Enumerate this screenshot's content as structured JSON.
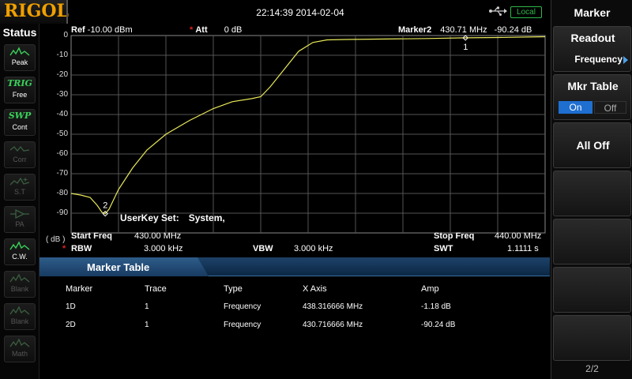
{
  "brand": {
    "logo": "RIGOL"
  },
  "topbar": {
    "datetime": "22:14:39 2014-02-04",
    "local_label": "Local",
    "usb_icon": "usb-icon"
  },
  "status": {
    "title": "Status",
    "buttons": [
      {
        "icon": "peak-icon",
        "label": "Peak",
        "active": true
      },
      {
        "icon": "TRIG",
        "label": "Free",
        "active": true
      },
      {
        "icon": "SWP",
        "label": "Cont",
        "active": true
      },
      {
        "icon": "corr-icon",
        "label": "Corr",
        "active": false
      },
      {
        "icon": "st-icon",
        "label": "S.T",
        "active": false
      },
      {
        "icon": "pa-icon",
        "label": "PA",
        "active": false
      },
      {
        "icon": "cw-icon",
        "label": "C.W.",
        "active": true
      },
      {
        "icon": "blank-icon",
        "label": "Blank",
        "active": false
      },
      {
        "icon": "blank-icon",
        "label": "Blank",
        "active": false
      },
      {
        "icon": "math-icon",
        "label": "Math",
        "active": false
      }
    ]
  },
  "header": {
    "ref_label": "Ref",
    "ref_value": "-10.00 dBm",
    "att_label": "Att",
    "att_value": "0 dB",
    "marker_label": "Marker2",
    "marker_freq": "430.71 MHz",
    "marker_amp": "-90.24 dB"
  },
  "plot": {
    "y_ticks": [
      "0",
      "-10",
      "-20",
      "-30",
      "-40",
      "-50",
      "-60",
      "-70",
      "-80",
      "-90"
    ],
    "unit": "( dB )",
    "userkey_label": "UserKey Set:",
    "userkey_value": "System,",
    "marker1_label": "1",
    "marker2_label": "2",
    "start_freq_label": "Start Freq",
    "start_freq_value": "430.00 MHz",
    "stop_freq_label": "Stop Freq",
    "stop_freq_value": "440.00 MHz",
    "rbw_label": "RBW",
    "rbw_value": "3.000 kHz",
    "vbw_label": "VBW",
    "vbw_value": "3.000 kHz",
    "swt_label": "SWT",
    "swt_value": "1.1111 s",
    "trace_color": "#e8e85a",
    "grid_color": "#555555"
  },
  "chart_data": {
    "type": "line",
    "xlim": [
      430.0,
      440.0
    ],
    "ylim": [
      -100,
      0
    ],
    "x": [
      430.0,
      430.2,
      430.4,
      430.55,
      430.65,
      430.72,
      430.8,
      431.0,
      431.3,
      431.6,
      432.0,
      432.5,
      433.0,
      433.4,
      433.8,
      434.0,
      434.2,
      434.5,
      434.8,
      435.1,
      435.4,
      435.8,
      436.5,
      437.5,
      438.32,
      439.0,
      440.0
    ],
    "y": [
      -80,
      -80.8,
      -82,
      -86,
      -89.5,
      -90.24,
      -88,
      -78,
      -67,
      -58,
      -50,
      -43,
      -37,
      -33.5,
      -32,
      -31,
      -26,
      -17,
      -8,
      -3.5,
      -2.2,
      -2.0,
      -1.8,
      -1.5,
      -1.18,
      -1.0,
      -0.6
    ],
    "markers": [
      {
        "label": "1",
        "x": 438.32,
        "y": -1.18
      },
      {
        "label": "2",
        "x": 430.72,
        "y": -90.24
      }
    ]
  },
  "marker_table": {
    "title": "Marker Table",
    "columns": [
      "Marker",
      "Trace",
      "Type",
      "X Axis",
      "Amp"
    ],
    "rows": [
      [
        "1D",
        "1",
        "Frequency",
        "438.316666 MHz",
        "-1.18 dB"
      ],
      [
        "2D",
        "1",
        "Frequency",
        "430.716666 MHz",
        "-90.24 dB"
      ]
    ]
  },
  "menu": {
    "title": "Marker",
    "readout_label": "Readout",
    "readout_value": "Frequency",
    "mkr_table_label": "Mkr Table",
    "on_label": "On",
    "off_label": "Off",
    "all_off_label": "All Off",
    "page": "2/2",
    "accent": "#1e6fd0"
  }
}
